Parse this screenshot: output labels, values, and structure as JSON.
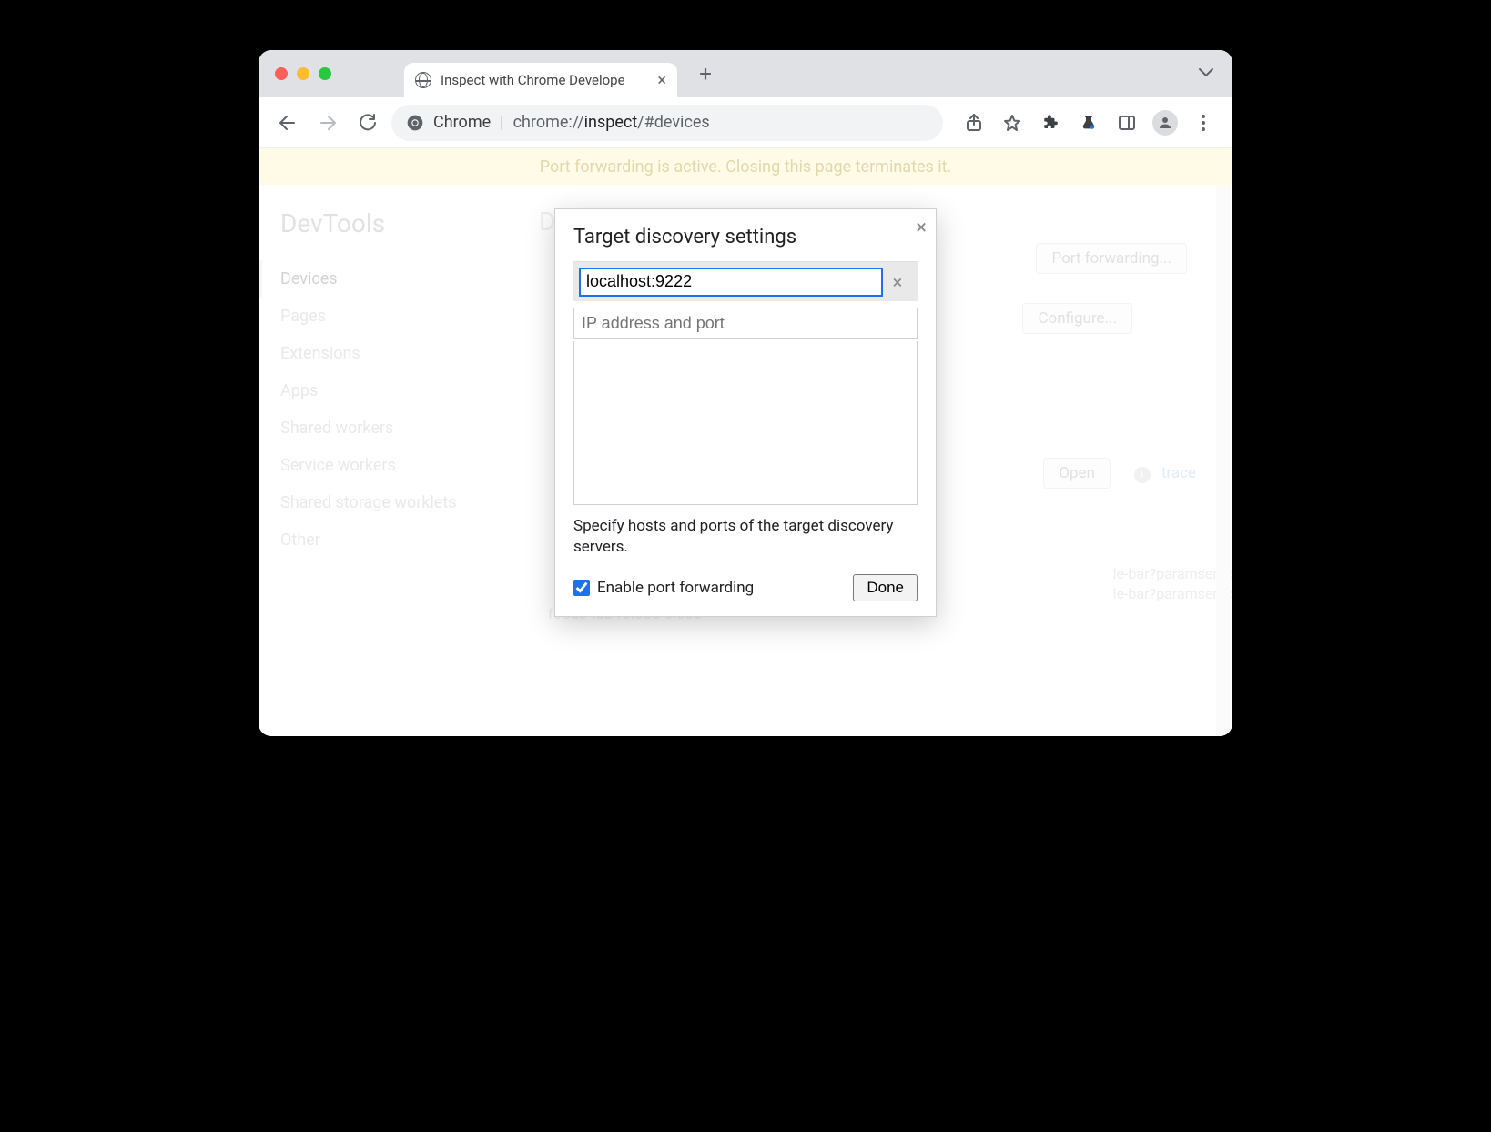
{
  "window": {
    "traffic": {
      "close": "#ff5f57",
      "min": "#febc2e",
      "max": "#28c840"
    }
  },
  "tab": {
    "title": "Inspect with Chrome Develope"
  },
  "omnibox": {
    "scheme_label": "Chrome",
    "path_prefix": "chrome://",
    "path_bold": "inspect",
    "path_suffix": "/#devices"
  },
  "banner": "Port forwarding is active. Closing this page terminates it.",
  "sidebar": {
    "title": "DevTools",
    "items": [
      "Devices",
      "Pages",
      "Extensions",
      "Apps",
      "Shared workers",
      "Service workers",
      "Shared storage worklets",
      "Other"
    ],
    "active_index": 0
  },
  "main": {
    "heading": "Devices",
    "port_forwarding_btn": "Port forwarding...",
    "configure_btn": "Configure...",
    "open_btn": "Open",
    "trace_link": "trace",
    "ghost_line1": "le-bar?paramsencoded=",
    "ghost_line2": "le-bar?paramsencoded=",
    "ghost_actions": "focus tab   reload   close"
  },
  "dialog": {
    "title": "Target discovery settings",
    "entry_value": "localhost:9222",
    "placeholder": "IP address and port",
    "help": "Specify hosts and ports of the target discovery servers.",
    "checkbox_label": "Enable port forwarding",
    "checkbox_checked": true,
    "done_label": "Done"
  }
}
